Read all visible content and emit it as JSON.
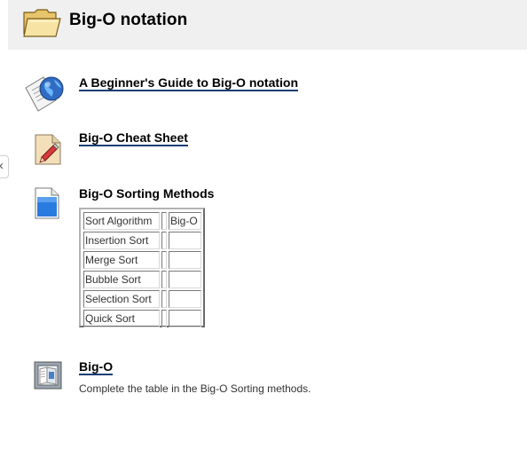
{
  "section": {
    "title": "Big-O notation"
  },
  "activities": [
    {
      "name": "A Beginner's Guide to Big-O notation",
      "icon": "web-page-globe-icon"
    },
    {
      "name": "Big-O Cheat Sheet",
      "icon": "file-pen-icon"
    },
    {
      "name": "Big-O Sorting Methods",
      "icon": "document-blue-icon"
    },
    {
      "name": "Big-O",
      "icon": "book-icon"
    }
  ],
  "sort_table": {
    "headers": [
      "Sort Algorithm",
      "",
      "Big-O"
    ],
    "rows": [
      [
        "Insertion Sort",
        "",
        ""
      ],
      [
        "Merge Sort",
        "",
        ""
      ],
      [
        "Bubble Sort",
        "",
        ""
      ],
      [
        "Selection Sort",
        "",
        ""
      ],
      [
        "Quick Sort",
        "",
        ""
      ]
    ]
  },
  "big_o_description": "Complete the table in the Big-O Sorting methods.",
  "left_tab_glyph": "‹"
}
